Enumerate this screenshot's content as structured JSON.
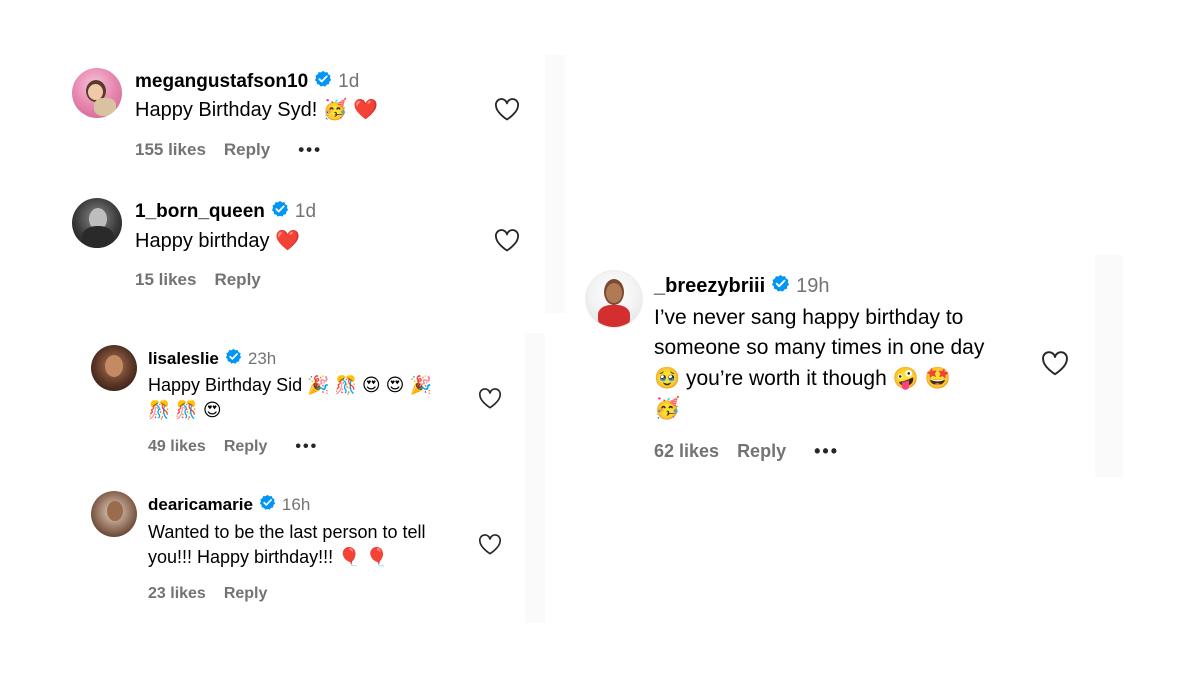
{
  "comments": [
    {
      "username": "megangustafson10",
      "time": "1d",
      "text": "Happy Birthday Syd! 🥳 ❤️",
      "likes": "155 likes",
      "reply": "Reply",
      "more": "•••"
    },
    {
      "username": "1_born_queen",
      "time": "1d",
      "text": "Happy birthday ❤️",
      "likes": "15 likes",
      "reply": "Reply"
    },
    {
      "username": "lisaleslie",
      "time": "23h",
      "text_line1": "Happy Birthday Sid 🎉 🎊 😍 😍 🎉",
      "text_line2": "🎊 🎊 😍",
      "likes": "49 likes",
      "reply": "Reply",
      "more": "•••"
    },
    {
      "username": "dearicamarie",
      "time": "16h",
      "text_line1": "Wanted to be the last person to tell",
      "text_line2": "you!!! Happy birthday!!! 🎈 🎈",
      "likes": "23 likes",
      "reply": "Reply"
    },
    {
      "username": "_breezybriii",
      "time": "19h",
      "text_line1": "I’ve never sang happy birthday to",
      "text_line2": "someone so many times in one day",
      "text_line3": "🥹 you’re worth it though 🤪 🤩",
      "text_line4": "🥳",
      "likes": "62 likes",
      "reply": "Reply",
      "more": "•••"
    }
  ],
  "colors": {
    "verified": "#0095f6",
    "muted": "#737373",
    "panel": "#fafafa"
  },
  "icons": {
    "verified": "verified-badge-icon",
    "like": "heart-outline-icon"
  }
}
